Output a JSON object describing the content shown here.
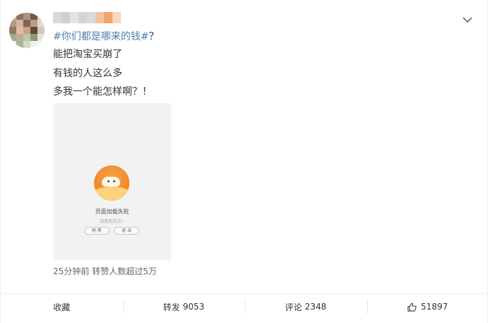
{
  "post": {
    "topic": "#你们都是哪来的钱#",
    "topic_suffix": "？",
    "lines": [
      "能把淘宝买崩了",
      "有钱的人这么多",
      "多我一个能怎样啊？！"
    ],
    "meta": "25分钟前  转赞人数超过5万"
  },
  "image": {
    "title": "页面加载失败",
    "hint": "请重新尝试~",
    "buttons": [
      "刷 新",
      "退 出"
    ]
  },
  "actions": [
    {
      "label": "收藏",
      "count": ""
    },
    {
      "label": "转发",
      "count": "9053"
    },
    {
      "label": "评论",
      "count": "2348"
    },
    {
      "label": "",
      "count": "51897",
      "icon": "thumbs-up-icon"
    }
  ],
  "icons": {
    "menu": "chevron-down-icon",
    "like": "thumbs-up-icon"
  },
  "colors": {
    "topic": "#507daf",
    "mascot": "#f08a2c"
  }
}
